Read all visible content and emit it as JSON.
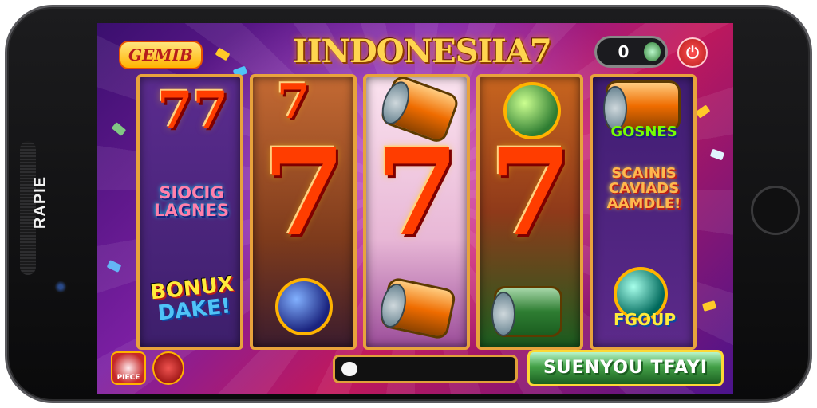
{
  "device": {
    "brand": "RAPIE"
  },
  "header": {
    "logo_text": "GEMIB",
    "title": "IINDONESIIA7",
    "credit_value": "0"
  },
  "reels": {
    "r1": {
      "top_symbol": "77",
      "art_text": "SIOCIG LAGNES",
      "bonus_line1": "BONUX",
      "bonus_line2": "DAKE!"
    },
    "r2": {
      "top_symbol": "7",
      "mid_symbol": "7"
    },
    "r3": {
      "mid_symbol": "7"
    },
    "r4": {
      "mid_symbol": "7"
    },
    "r5": {
      "text_1": "GOSNES",
      "text_2": "SCAINIS CAVIADS AAMDLE!",
      "text_3": "FGOUP"
    }
  },
  "footer": {
    "mini_button_text": "PIECE",
    "action_button_label": "SUENYOU  TFAYI"
  },
  "colors": {
    "reel_border": "#e8a33c",
    "action_button": "#43a047",
    "power_button": "#d32f2f"
  }
}
